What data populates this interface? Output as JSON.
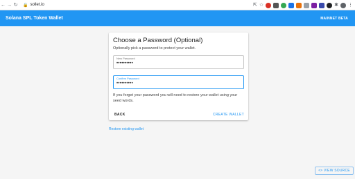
{
  "browser": {
    "url": "sollet.io",
    "icons": [
      "back-arrow-icon",
      "forward-arrow-icon",
      "reload-icon",
      "lock-icon",
      "star-icon",
      "extensions-icon",
      "profile-icon",
      "menu-icon"
    ]
  },
  "appbar": {
    "title": "Solana SPL Token Wallet",
    "network": "MAINNET BETA"
  },
  "card": {
    "title": "Choose a Password (Optional)",
    "subtitle": "Optionally pick a password to protect your wallet.",
    "new_password": {
      "label": "New Password",
      "value": "••••••••••"
    },
    "confirm_password": {
      "label": "Confirm Password",
      "value": "••••••••••"
    },
    "hint": "If you forget your password you will need to restore your wallet using your seed words.",
    "back_label": "BACK",
    "create_label": "CREATE WALLET"
  },
  "restore_link": "Restore existing wallet",
  "view_source": {
    "icon": "code-icon",
    "label": "VIEW SOURCE"
  },
  "colors": {
    "accent": "#2196f3",
    "background": "#f5f5f5"
  }
}
